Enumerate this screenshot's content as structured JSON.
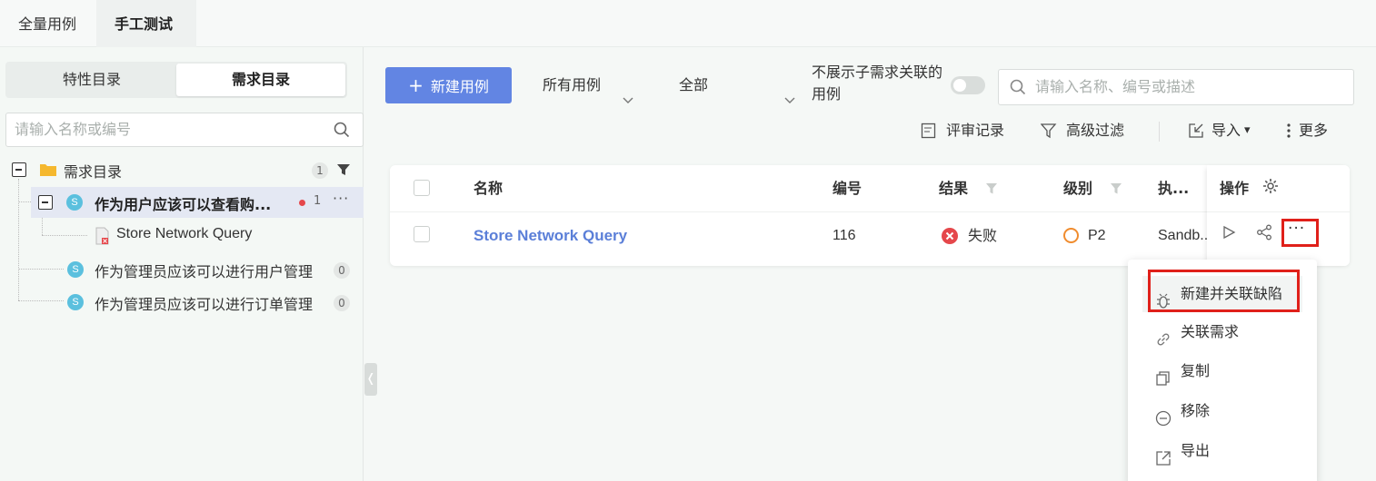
{
  "top_tabs": [
    {
      "label": "全量用例"
    },
    {
      "label": "手工测试"
    }
  ],
  "left_panel": {
    "segments": [
      "特性目录",
      "需求目录"
    ],
    "search_placeholder": "请输入名称或编号",
    "tree": {
      "root": {
        "label": "需求目录",
        "count": "1"
      },
      "items": [
        {
          "label": "作为用户应该可以查看购...",
          "count": "1",
          "badge": "S",
          "more": "···"
        },
        {
          "label": "Store Network Query"
        },
        {
          "label": "作为管理员应该可以进行用户管理",
          "count": "0",
          "badge": "S"
        },
        {
          "label": "作为管理员应该可以进行订单管理",
          "count": "0",
          "badge": "S"
        }
      ]
    },
    "collapse_glyph": "❬"
  },
  "toolbar": {
    "new_button": "新建用例",
    "new_icon": "+",
    "filter_all_cases": "所有用例",
    "filter_all": "全部",
    "toggle_label": "不展示子需求关联的用例",
    "search_placeholder": "请输入名称、编号或描述",
    "review": "评审记录",
    "advanced_filter": "高级过滤",
    "import": "导入",
    "import_caret": "▾",
    "more": "更多"
  },
  "table": {
    "columns": [
      "名称",
      "编号",
      "结果",
      "级别",
      "执...",
      "操作"
    ],
    "rows": [
      {
        "name": "Store Network Query",
        "id": "116",
        "result": "失败",
        "level": "P2",
        "exec": "Sandb..."
      }
    ],
    "more_glyph": "···"
  },
  "menu": {
    "items": [
      {
        "label": "新建并关联缺陷",
        "icon": "bug-icon"
      },
      {
        "label": "关联需求",
        "icon": "link-icon"
      },
      {
        "label": "复制",
        "icon": "copy-icon"
      },
      {
        "label": "移除",
        "icon": "minus-circle-icon"
      },
      {
        "label": "导出",
        "icon": "export-icon"
      }
    ]
  },
  "colors": {
    "primary": "#6285e3",
    "fail": "#e5474b",
    "level_p2": "#f08c2e",
    "badge": "#5bc0de",
    "highlight": "#e0201a",
    "folder": "#f5b82e"
  }
}
